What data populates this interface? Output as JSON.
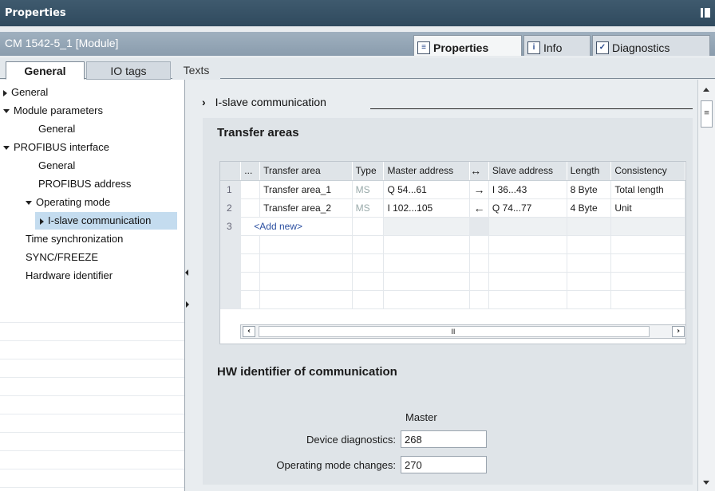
{
  "window": {
    "title": "Properties"
  },
  "module": {
    "title": "CM 1542-5_1 [Module]"
  },
  "main_tabs": [
    {
      "label": "Properties",
      "icon": "properties-icon"
    },
    {
      "label": "Info",
      "icon": "info-icon"
    },
    {
      "label": "Diagnostics",
      "icon": "diagnostics-icon"
    }
  ],
  "sub_tabs": [
    "General",
    "IO tags",
    "Texts"
  ],
  "tree": [
    "General",
    "Module parameters",
    "General",
    "PROFIBUS interface",
    "General",
    "PROFIBUS address",
    "Operating mode",
    "I-slave communication",
    "Time synchronization",
    "SYNC/FREEZE",
    "Hardware identifier"
  ],
  "section": {
    "title": "I-slave communication"
  },
  "transfer_areas": {
    "title": "Transfer areas",
    "columns": [
      "...",
      "Transfer area",
      "Type",
      "Master address",
      "↔",
      "Slave address",
      "Length",
      "Consistency"
    ],
    "rows": [
      {
        "num": "1",
        "name": "Transfer area_1",
        "type": "MS",
        "master": "Q 54...61",
        "dir": "→",
        "slave": "I 36...43",
        "length": "8 Byte",
        "consistency": "Total length"
      },
      {
        "num": "2",
        "name": "Transfer area_2",
        "type": "MS",
        "master": "I 102...105",
        "dir": "←",
        "slave": "Q 74...77",
        "length": "4 Byte",
        "consistency": "Unit"
      }
    ],
    "add_row": {
      "num": "3",
      "label": "<Add new>"
    },
    "scroll_grip": "III"
  },
  "hw_identifier": {
    "title": "HW identifier of communication",
    "column_label": "Master",
    "fields": [
      {
        "label": "Device diagnostics:",
        "value": "268"
      },
      {
        "label": "Operating mode changes:",
        "value": "270"
      }
    ]
  },
  "colors": {
    "titlebar": "#2f4a5e",
    "selection": "#c4dcef",
    "link": "#2b4fa0"
  }
}
